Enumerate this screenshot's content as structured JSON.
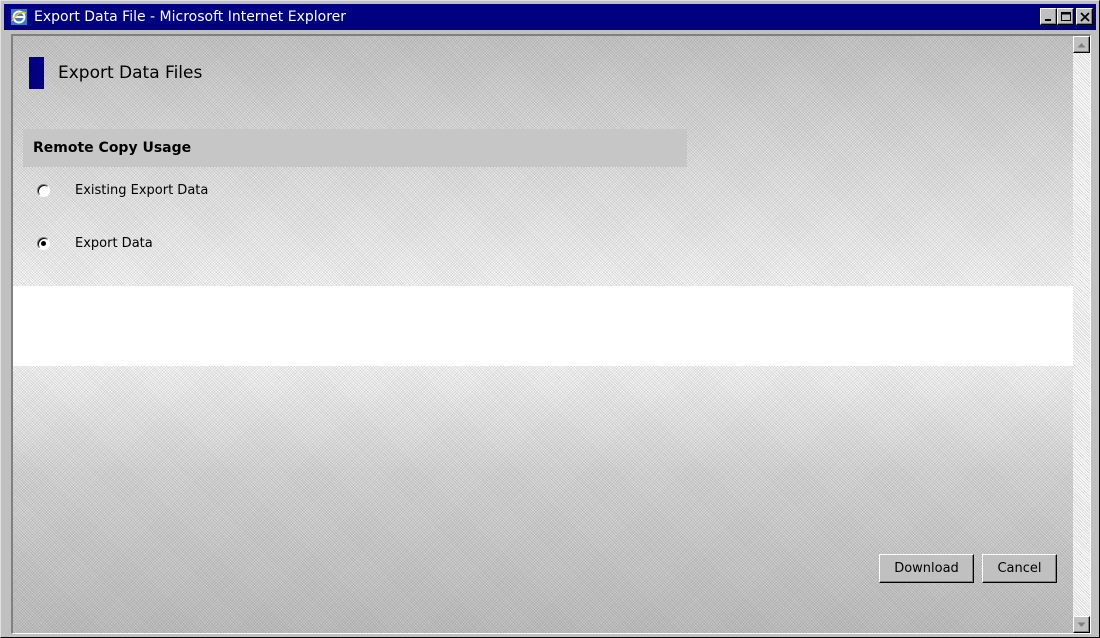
{
  "window": {
    "title": "Export Data File - Microsoft Internet Explorer",
    "controls": {
      "minimize": "minimize-icon",
      "maximize": "maximize-icon",
      "close": "close-icon"
    },
    "app_icon": "internet-explorer-icon"
  },
  "page": {
    "title": "Export Data Files",
    "accent_color": "#000080"
  },
  "section": {
    "title": "Remote Copy Usage",
    "options": [
      {
        "label": "Existing Export Data",
        "selected": false
      },
      {
        "label": "Export Data",
        "selected": true
      }
    ]
  },
  "buttons": {
    "download": "Download",
    "cancel": "Cancel"
  }
}
